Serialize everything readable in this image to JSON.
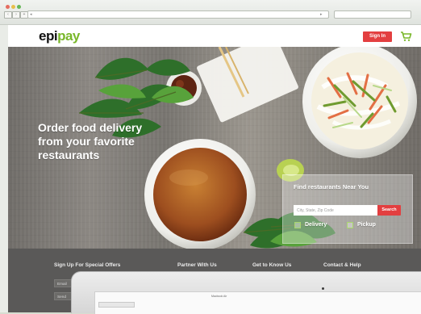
{
  "browser": {
    "url_left": "◂",
    "url_right": "▸"
  },
  "site": {
    "logo_main": "epi",
    "logo_accent": "pay",
    "sign_in": "Sign In",
    "hero_headline": "Order food delivery from your favorite restaurants",
    "find_title": "Find restaurants Near You",
    "find_placeholder": "City, State, Zip Code",
    "search_label": "Search",
    "delivery_label": "Delivery",
    "pickup_label": "Pickup"
  },
  "footer": {
    "special_offers": "Sign Up For Special Offers",
    "partner": "Partner With Us",
    "know_us": "Get to Know Us",
    "contact": "Contact & Help",
    "email_placeholder": "Email",
    "send_placeholder": "Send"
  },
  "laptop": {
    "window_title": "Macbook Air"
  },
  "colors": {
    "accent": "#e33f40",
    "logo_green": "#79b72a",
    "footer": "#5a5958"
  }
}
